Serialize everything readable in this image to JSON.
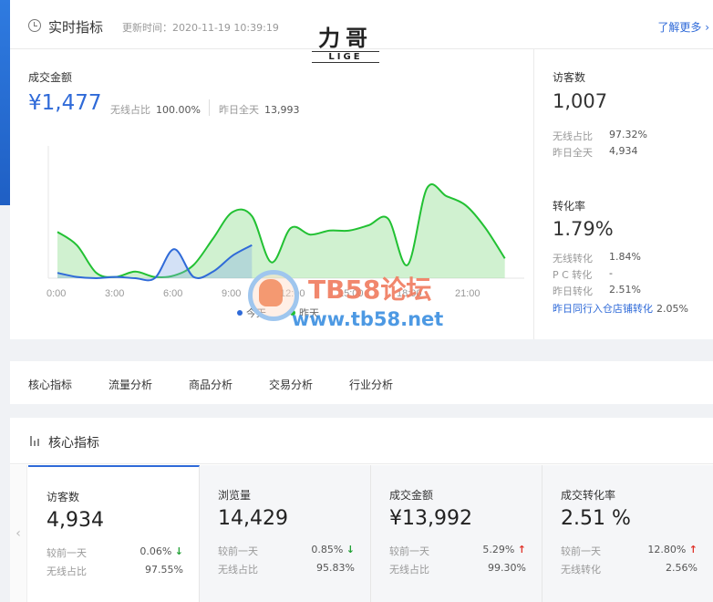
{
  "realtime": {
    "title": "实时指标",
    "update_time": "更新时间：2020-11-19 10:39:19",
    "more_link": "了解更多 ›",
    "logo": {
      "zh": "力哥",
      "en": "LIGE"
    },
    "sales": {
      "label": "成交金额",
      "value": "¥1,477",
      "wireless_label": "无线占比",
      "wireless_value": "100.00%",
      "yesterday_label": "昨日全天",
      "yesterday_value": "13,993"
    },
    "visitors": {
      "label": "访客数",
      "value": "1,007",
      "wireless_label": "无线占比",
      "wireless_value": "97.32%",
      "yesterday_label": "昨日全天",
      "yesterday_value": "4,934"
    },
    "conversion": {
      "label": "转化率",
      "value": "1.79%",
      "rows": [
        {
          "label": "无线转化",
          "value": "1.84%"
        },
        {
          "label": "P C 转化",
          "value": "-"
        },
        {
          "label": "昨日转化",
          "value": "2.51%"
        }
      ],
      "peer_label": "昨日同行入仓店铺转化",
      "peer_value": "2.05%"
    }
  },
  "chart_data": {
    "type": "area",
    "x_ticks": [
      "0:00",
      "3:00",
      "6:00",
      "9:00",
      "12:00",
      "15:00",
      "18:00",
      "21:00"
    ],
    "x_range": [
      0,
      24
    ],
    "y_range": [
      0,
      100
    ],
    "legend": [
      "今天",
      "昨天"
    ],
    "legend_position": "bottom",
    "series": [
      {
        "name": "昨天",
        "color": "#22c133",
        "x": [
          0,
          1,
          2,
          3,
          4,
          5,
          6,
          7,
          8,
          9,
          10,
          11,
          12,
          13,
          14,
          15,
          16,
          17,
          18,
          19,
          20,
          21,
          22,
          23
        ],
        "values": [
          35,
          25,
          4,
          1,
          5,
          1,
          2,
          10,
          30,
          50,
          47,
          12,
          38,
          33,
          36,
          36,
          40,
          45,
          10,
          68,
          62,
          55,
          38,
          15
        ]
      },
      {
        "name": "今天",
        "color": "#2f6ad8",
        "x": [
          0,
          1,
          2,
          3,
          4,
          5,
          6,
          7,
          8,
          9,
          10
        ],
        "values": [
          4,
          1,
          0,
          1,
          0,
          0,
          22,
          1,
          5,
          17,
          25
        ]
      }
    ]
  },
  "tabs": [
    "核心指标",
    "流量分析",
    "商品分析",
    "交易分析",
    "行业分析"
  ],
  "core": {
    "title": "核心指标",
    "arrow": "‹",
    "cards": [
      {
        "title": "访客数",
        "value": "4,934",
        "r1_label": "较前一天",
        "r1_value": "0.06%",
        "r1_trend": "↓",
        "r2_label": "无线占比",
        "r2_value": "97.55%"
      },
      {
        "title": "浏览量",
        "value": "14,429",
        "r1_label": "较前一天",
        "r1_value": "0.85%",
        "r1_trend": "↓",
        "r2_label": "无线占比",
        "r2_value": "95.83%"
      },
      {
        "title": "成交金额",
        "value": "¥13,992",
        "r1_label": "较前一天",
        "r1_value": "5.29%",
        "r1_trend": "↑",
        "r2_label": "无线占比",
        "r2_value": "99.30%"
      },
      {
        "title": "成交转化率",
        "value": "2.51 %",
        "r1_label": "较前一天",
        "r1_value": "12.80%",
        "r1_trend": "↑",
        "r2_label": "无线转化",
        "r2_value": "2.56%"
      }
    ]
  },
  "watermark": {
    "line1": "TB58论坛",
    "line2": "www.tb58.net"
  }
}
